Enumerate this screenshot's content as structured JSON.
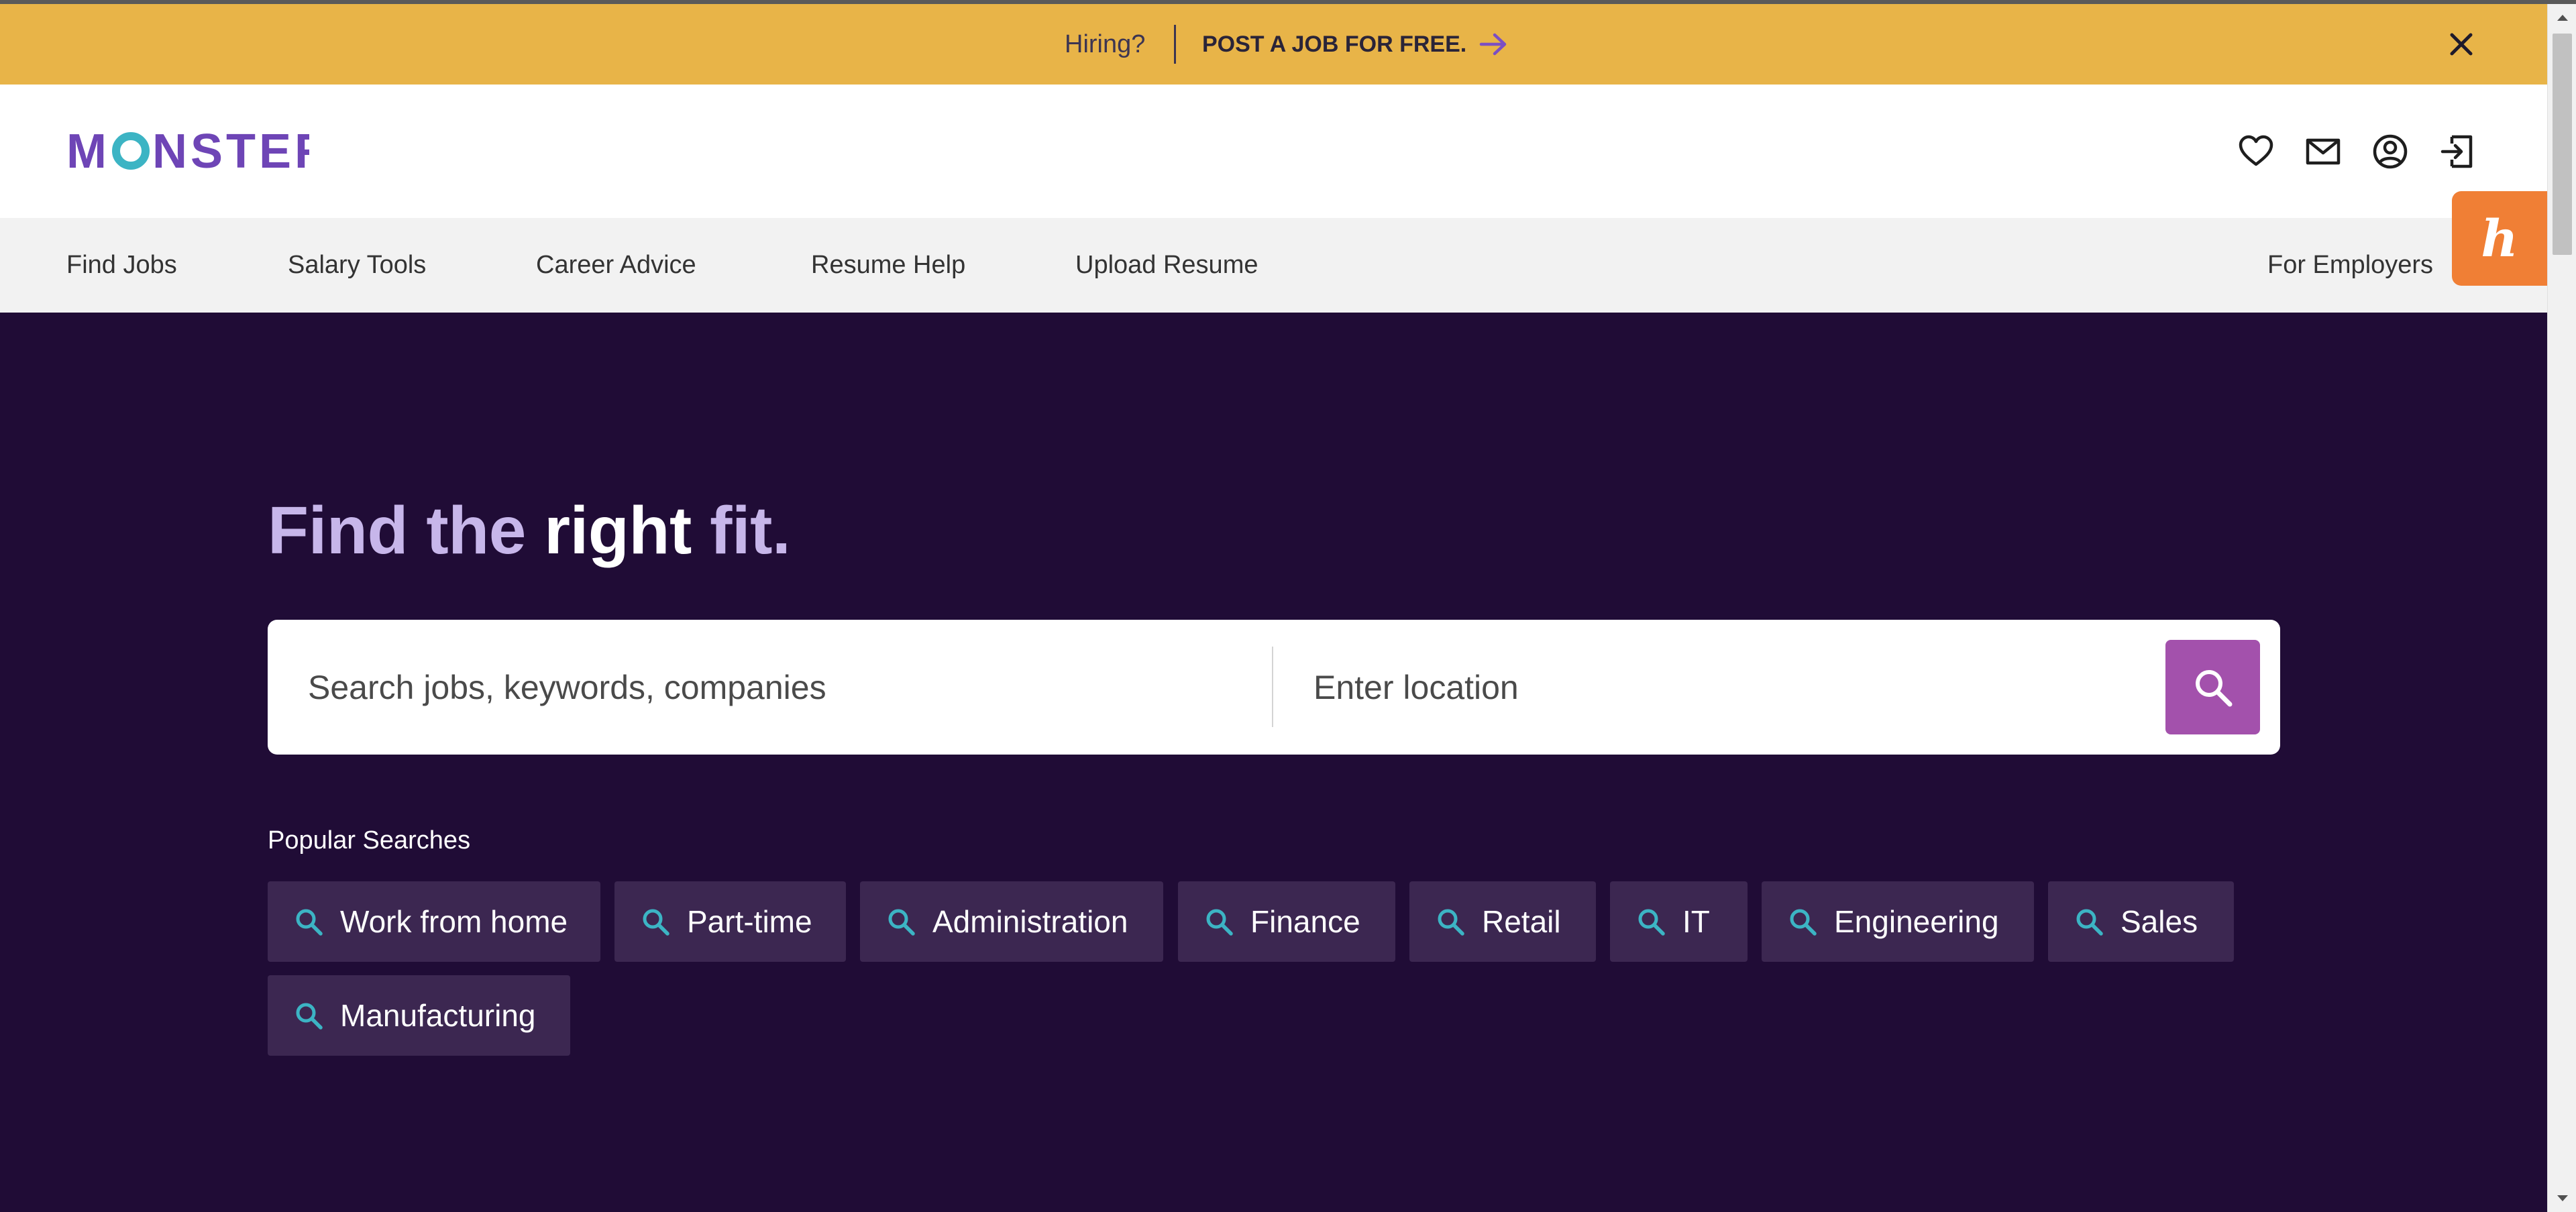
{
  "banner": {
    "hiring_text": "Hiring?",
    "cta_label": "POST A JOB FOR FREE.",
    "close_icon": "close-icon",
    "arrow_icon": "arrow-right-icon"
  },
  "header": {
    "logo_text": "MONSTER",
    "icons": [
      "heart-icon",
      "mail-icon",
      "account-icon",
      "sign-in-icon"
    ]
  },
  "nav": {
    "items": [
      "Find Jobs",
      "Salary Tools",
      "Career Advice",
      "Resume Help",
      "Upload Resume"
    ],
    "employers": "For Employers"
  },
  "honey": {
    "glyph": "h"
  },
  "hero": {
    "title_part1": "Find the ",
    "title_part2": "right",
    "title_part3": " fit."
  },
  "search": {
    "keyword_placeholder": "Search jobs, keywords, companies",
    "location_placeholder": "Enter location",
    "button_icon": "search-icon"
  },
  "popular": {
    "label": "Popular Searches",
    "chips": [
      "Work from home",
      "Part-time",
      "Administration",
      "Finance",
      "Retail",
      "IT",
      "Engineering",
      "Sales",
      "Manufacturing"
    ]
  },
  "colors": {
    "banner": "#e8b448",
    "hero": "#200c36",
    "title_light": "#c7b6ea",
    "search_button": "#a351ac",
    "chip": "#3c2751",
    "chip_icon": "#3cb4c4",
    "logo": "#6e45b6",
    "logo_accent": "#3cb4c4",
    "honey": "#f07f35"
  }
}
